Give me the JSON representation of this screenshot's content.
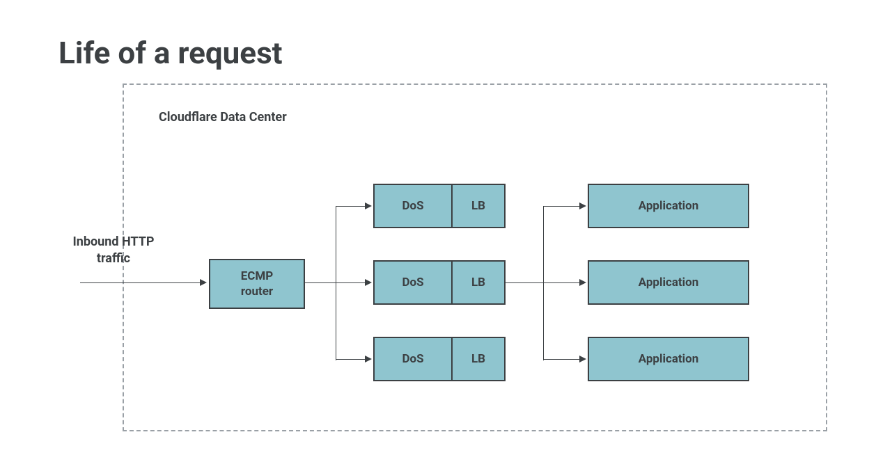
{
  "title": "Life of a request",
  "data_center_label": "Cloudflare Data Center",
  "inbound_label": "Inbound HTTP traffic",
  "ecmp_label": "ECMP\nrouter",
  "middle_rows": [
    {
      "dos": "DoS",
      "lb": "LB"
    },
    {
      "dos": "DoS",
      "lb": "LB"
    },
    {
      "dos": "DoS",
      "lb": "LB"
    }
  ],
  "apps": [
    "Application",
    "Application",
    "Application"
  ],
  "colors": {
    "box_fill": "#8fc5cf",
    "box_border": "#3c4043",
    "dashed_border": "#9aa0a6",
    "text": "#3c4043"
  }
}
